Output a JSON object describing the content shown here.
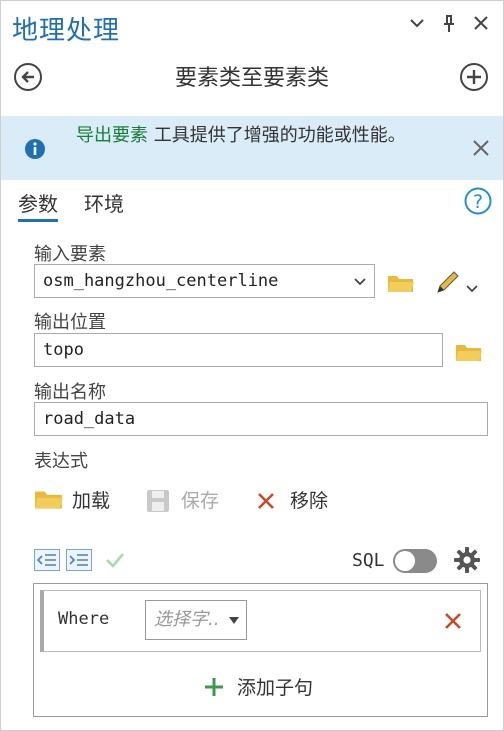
{
  "header": {
    "title": "地理处理",
    "tool_title": "要素类至要素类"
  },
  "info": {
    "link_text": "导出要素",
    "message": " 工具提供了增强的功能或性能。"
  },
  "tabs": [
    {
      "label": "参数"
    },
    {
      "label": "环境"
    }
  ],
  "params": {
    "input_label": "输入要素",
    "input_value": "osm_hangzhou_centerline",
    "output_location_label": "输出位置",
    "output_location_value": "topo",
    "output_name_label": "输出名称",
    "output_name_value": "road_data",
    "expression_label": "表达式"
  },
  "expression": {
    "load_label": "加载",
    "save_label": "保存",
    "remove_label": "移除",
    "sql_label": "SQL",
    "sql_enabled": false,
    "where_label": "Where",
    "field_placeholder": "选择字..",
    "add_clause_label": "添加子句"
  },
  "colors": {
    "accent": "#1f6fb2",
    "info_bg": "#d9ecf8",
    "link": "#1a7f37",
    "remove": "#c84a2c",
    "add": "#3a9a4a",
    "folder": "#e7b93c"
  }
}
